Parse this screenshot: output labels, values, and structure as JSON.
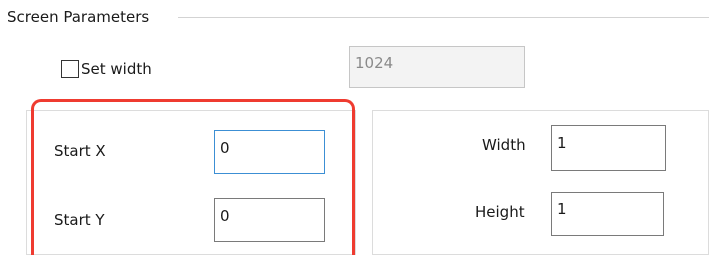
{
  "group": {
    "title": "Screen Parameters"
  },
  "set_width": {
    "label": "Set width",
    "checked": false,
    "value": "1024"
  },
  "start": {
    "x": {
      "label": "Start X",
      "value": "0"
    },
    "y": {
      "label": "Start Y",
      "value": "0"
    }
  },
  "size": {
    "width": {
      "label": "Width",
      "value": "1"
    },
    "height": {
      "label": "Height",
      "value": "1"
    }
  },
  "colors": {
    "highlight": "#ef3b30",
    "focus_border": "#3c8fd4",
    "field_border": "#7a7a7a",
    "disabled_field_border": "#c6c6c6"
  }
}
